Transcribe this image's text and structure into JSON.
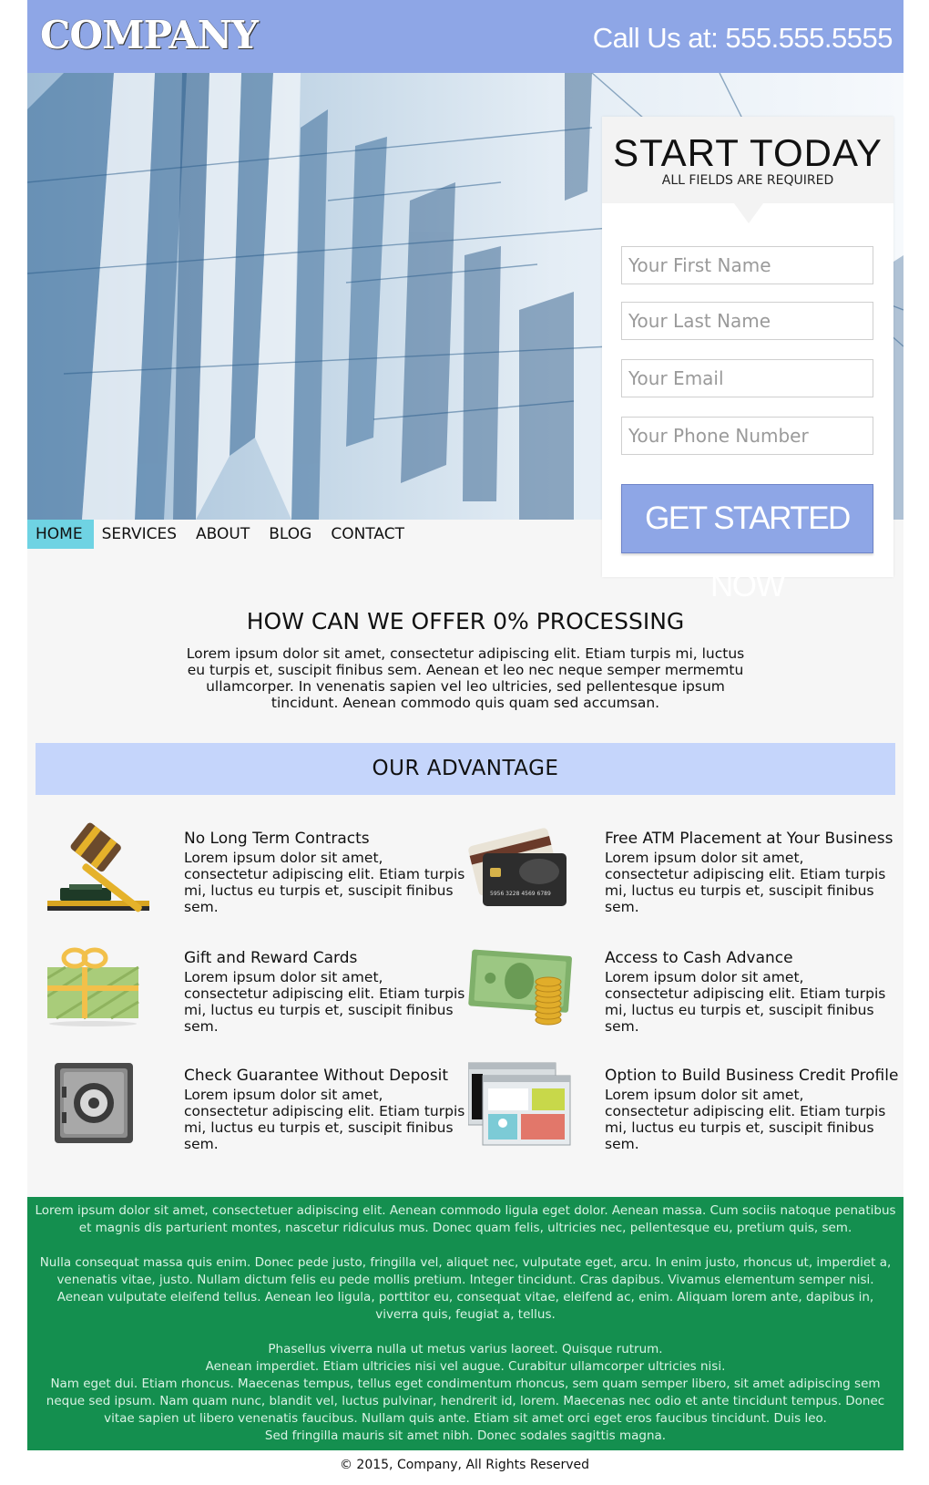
{
  "header": {
    "logo": "COMPANY",
    "phone": "Call Us at: 555.555.5555"
  },
  "nav": {
    "items": [
      "HOME",
      "SERVICES",
      "ABOUT",
      "BLOG",
      "CONTACT"
    ],
    "active": "HOME"
  },
  "form": {
    "title": "START TODAY",
    "subtitle": "ALL FIELDS ARE REQUIRED",
    "fields": [
      {
        "placeholder": "Your First Name",
        "value": ""
      },
      {
        "placeholder": "Your Last Name",
        "value": ""
      },
      {
        "placeholder": "Your Email",
        "value": ""
      },
      {
        "placeholder": "Your Phone Number",
        "value": ""
      }
    ],
    "button": "GET STARTED NOW"
  },
  "intro": {
    "title": "HOW CAN WE OFFER 0% PROCESSING",
    "text": "Lorem ipsum dolor sit amet, consectetur adipiscing elit. Etiam turpis mi, luctus eu turpis et, suscipit finibus sem. Aenean et leo nec neque semper mermemtu ullamcorper. In venenatis sapien vel leo ultricies, sed pellentesque ipsum tincidunt. Aenean commodo quis quam sed accumsan."
  },
  "advantage": {
    "title": "OUR ADVANTAGE",
    "features": [
      {
        "title": "No Long Term Contracts",
        "icon": "gavel-icon",
        "desc": "Lorem ipsum dolor sit amet, consectetur adipiscing elit. Etiam turpis mi, luctus eu turpis et, suscipit finibus sem."
      },
      {
        "title": "Free ATM Placement at Your Business",
        "icon": "credit-card-icon",
        "card_number": "5956 3228 4569 6789",
        "desc": "Lorem ipsum dolor sit amet, consectetur adipiscing elit. Etiam turpis mi, luctus eu turpis et, suscipit finibus sem."
      },
      {
        "title": "Gift and Reward Cards",
        "icon": "gift-icon",
        "desc": "Lorem ipsum dolor sit amet, consectetur adipiscing elit. Etiam turpis mi, luctus eu turpis et, suscipit finibus sem."
      },
      {
        "title": "Access to Cash Advance",
        "icon": "cash-coins-icon",
        "desc": "Lorem ipsum dolor sit amet, consectetur adipiscing elit. Etiam turpis mi, luctus eu turpis et, suscipit finibus sem."
      },
      {
        "title": "Check Guarantee Without Deposit",
        "icon": "safe-icon",
        "desc": "Lorem ipsum dolor sit amet, consectetur adipiscing elit. Etiam turpis mi, luctus eu turpis et, suscipit finibus sem."
      },
      {
        "title": "Option to Build Business Credit Profile",
        "icon": "web-profile-icon",
        "desc": "Lorem ipsum dolor sit amet, consectetur adipiscing elit. Etiam turpis mi, luctus eu turpis et, suscipit finibus sem."
      }
    ]
  },
  "footer_text": {
    "p1": "Lorem ipsum dolor sit amet, consectetuer adipiscing elit. Aenean commodo ligula eget dolor. Aenean massa. Cum sociis natoque penatibus et magnis dis parturient montes, nascetur ridiculus mus. Donec quam felis, ultricies nec, pellentesque eu, pretium quis, sem.",
    "p2": "Nulla consequat massa quis enim. Donec pede justo, fringilla vel, aliquet nec, vulputate eget, arcu. In enim justo, rhoncus ut, imperdiet a, venenatis vitae, justo. Nullam dictum felis eu pede mollis pretium. Integer tincidunt. Cras dapibus. Vivamus elementum semper nisi. Aenean vulputate eleifend tellus. Aenean leo ligula, porttitor eu, consequat vitae, eleifend ac, enim. Aliquam lorem ante, dapibus in, viverra quis, feugiat a, tellus.",
    "p3": "Phasellus viverra nulla ut metus varius laoreet. Quisque rutrum.",
    "p4": "Aenean imperdiet. Etiam ultricies nisi vel augue. Curabitur ullamcorper ultricies nisi.",
    "p5": "Nam eget dui. Etiam rhoncus. Maecenas tempus, tellus eget condimentum rhoncus, sem quam semper libero, sit amet adipiscing sem neque sed ipsum. Nam quam nunc, blandit vel, luctus pulvinar, hendrerit id, lorem. Maecenas nec odio et ante tincidunt tempus. Donec vitae sapien ut libero venenatis faucibus. Nullam quis ante. Etiam sit amet orci eget eros faucibus tincidunt. Duis leo.",
    "p6": "Sed fringilla mauris sit amet nibh. Donec sodales sagittis magna."
  },
  "copyright": "© 2015, Company, All Rights Reserved",
  "colors": {
    "header": "#8ea6e6",
    "nav_active": "#6fd3e3",
    "advantage_bar": "#c5d5fb",
    "footer": "#148f4f"
  }
}
